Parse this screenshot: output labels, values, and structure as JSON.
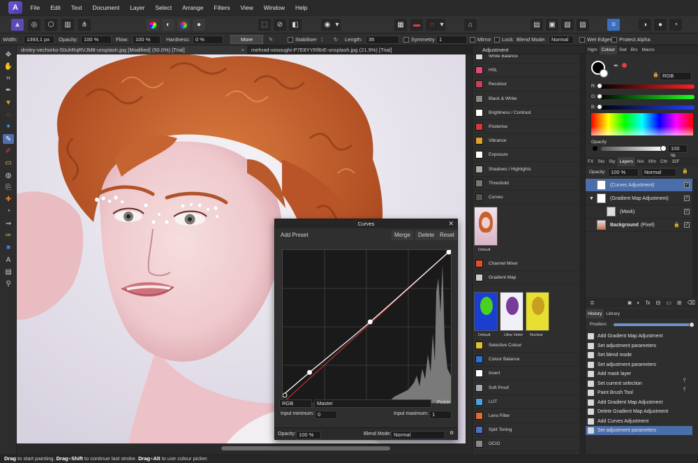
{
  "menu": [
    "File",
    "Edit",
    "Text",
    "Document",
    "Layer",
    "Select",
    "Arrange",
    "Filters",
    "View",
    "Window",
    "Help"
  ],
  "context_bar": {
    "width_label": "Width:",
    "width_value": "1393,1 px",
    "opacity_label": "Opacity:",
    "opacity_value": "100 %",
    "flow_label": "Flow:",
    "flow_value": "100 %",
    "hardness_label": "Hardness:",
    "hardness_value": "0 %",
    "more_label": "More",
    "stabiliser_label": "Stabiliser",
    "length_label": "Length:",
    "length_value": "35",
    "symmetry_label": "Symmetry",
    "symmetry_value": "1",
    "mirror_label": "Mirror",
    "lock_label": "Lock",
    "blend_mode_label": "Blend Mode:",
    "blend_mode_value": "Normal",
    "wet_edges_label": "Wet Edges",
    "protect_alpha_label": "Protect Alpha"
  },
  "doc_tabs": [
    {
      "label": "dmitry-vechorko-50uhRqRVJM8-unsplash.jpg [Modified] (50.0%) [Trial]"
    },
    {
      "label": "mehrad-vosoughi-P7E8YYRf6rE-unsplash.jpg (21.9%) [Trial]"
    }
  ],
  "adjustment_panel": {
    "tab": "Adjustment",
    "items": [
      {
        "label": "White Balance",
        "icon": "white-balance-icon",
        "color": "#dcdcdc"
      },
      {
        "label": "HSL",
        "icon": "hsl-icon",
        "color": "#e04a7a"
      },
      {
        "label": "Recolour",
        "icon": "recolour-icon",
        "color": "#c8405a"
      },
      {
        "label": "Black & White",
        "icon": "black-white-icon",
        "color": "#888888"
      },
      {
        "label": "Brightness / Contrast",
        "icon": "brightness-icon",
        "color": "#ffffff"
      },
      {
        "label": "Posterise",
        "icon": "posterise-icon",
        "color": "#d23a3a"
      },
      {
        "label": "Vibrance",
        "icon": "vibrance-icon",
        "color": "#e0a030"
      },
      {
        "label": "Exposure",
        "icon": "exposure-icon",
        "color": "#ffffff"
      },
      {
        "label": "Shadows / Highlights",
        "icon": "shadows-highlights-icon",
        "color": "#aaaaaa"
      },
      {
        "label": "Threshold",
        "icon": "threshold-icon",
        "color": "#777777"
      },
      {
        "label": "Curves",
        "icon": "curves-icon",
        "color": "#555555"
      }
    ],
    "curves_default_label": "Default",
    "items2": [
      {
        "label": "Channel Mixer",
        "icon": "channel-mixer-icon",
        "color": "#e05030"
      },
      {
        "label": "Gradient Map",
        "icon": "gradient-map-icon",
        "color": "#cccccc"
      }
    ],
    "gradient_presets": [
      "Default",
      "Ultra Violet",
      "Nuclear"
    ],
    "items3": [
      {
        "label": "Selective Colour",
        "icon": "selective-colour-icon",
        "color": "#e0c030"
      },
      {
        "label": "Colour Balance",
        "icon": "colour-balance-icon",
        "color": "#3070d0"
      },
      {
        "label": "Invert",
        "icon": "invert-icon",
        "color": "#ffffff"
      },
      {
        "label": "Soft Proof",
        "icon": "soft-proof-icon",
        "color": "#aaaaaa"
      },
      {
        "label": "LUT",
        "icon": "lut-icon",
        "color": "#50a0e0"
      },
      {
        "label": "Lens Filter",
        "icon": "lens-filter-icon",
        "color": "#e06a30"
      },
      {
        "label": "Split Toning",
        "icon": "split-toning-icon",
        "color": "#5070c0"
      },
      {
        "label": "OCIO",
        "icon": "ocio-icon",
        "color": "#888888"
      }
    ]
  },
  "colour_panel": {
    "tabs": [
      "Hgm",
      "Colour",
      "Swt",
      "Brs",
      "Macro"
    ],
    "active_tab": "Colour",
    "mode": "RGB",
    "r_label": "R:",
    "g_label": "G:",
    "b_label": "B:",
    "opacity_label": "Opacity",
    "opacity_value": "100 %",
    "opacity_fraction": 1.0
  },
  "layers_panel": {
    "tabs": [
      "FX",
      "Sto",
      "Sty",
      "Layers",
      "Nvi",
      "Xfm",
      "Chr",
      "32F"
    ],
    "active_tab": "Layers",
    "opacity_label": "Opacity:",
    "opacity_value": "100 %",
    "blend_value": "Normal",
    "layers": [
      {
        "label": "(Curves Adjustment)",
        "selected": true,
        "indent": 0
      },
      {
        "label": "(Gradient Map Adjustment)",
        "selected": false,
        "indent": 0
      },
      {
        "label": "(Mask)",
        "selected": false,
        "indent": 1
      },
      {
        "label": "Background",
        "suffix": "(Pixel)",
        "selected": false,
        "indent": 0
      }
    ]
  },
  "history_panel": {
    "tabs": [
      "History",
      "Library"
    ],
    "active_tab": "History",
    "position_label": "Position:",
    "position_fraction": 1.0,
    "items": [
      "Add Gradient Map Adjustment",
      "Set adjustment parameters",
      "Set blend mode",
      "Set adjustment parameters",
      "Add mask layer",
      "Set current selection",
      "Paint Brush Tool",
      "Add Gradient Map Adjustment",
      "Delete Gradient Map Adjustment",
      "Add Curves Adjustment",
      "Set adjustment parameters"
    ],
    "selected_index": 10
  },
  "curves_dialog": {
    "title": "Curves",
    "add_preset": "Add Preset",
    "merge": "Merge",
    "delete": "Delete",
    "reset": "Reset",
    "colour_space": "RGB",
    "channel": "Master",
    "picker": "Picker",
    "input_min_label": "Input minimum:",
    "input_min_value": "0",
    "input_max_label": "Input maximum:",
    "input_max_value": "1",
    "opacity_label": "Opacity:",
    "opacity_value": "100 %",
    "blend_mode_label": "Blend Mode:",
    "blend_mode_value": "Normal",
    "curve_points": [
      [
        0,
        0.05
      ],
      [
        0.16,
        0.2
      ],
      [
        0.52,
        0.53
      ],
      [
        1,
        1
      ]
    ]
  },
  "status": {
    "parts": [
      {
        "b": "Drag",
        "t": " to start painting. "
      },
      {
        "b": "Drag",
        "t": "+"
      },
      {
        "b": "Shift",
        "t": " to continue last stroke. "
      },
      {
        "b": "Drag",
        "t": "+"
      },
      {
        "b": "Alt",
        "t": " to use colour picker."
      }
    ]
  },
  "colors": {
    "accent": "#4a6ea9",
    "hair": "#c4602c",
    "curve_line": "#ffffff",
    "diagonal": "#c03030"
  }
}
